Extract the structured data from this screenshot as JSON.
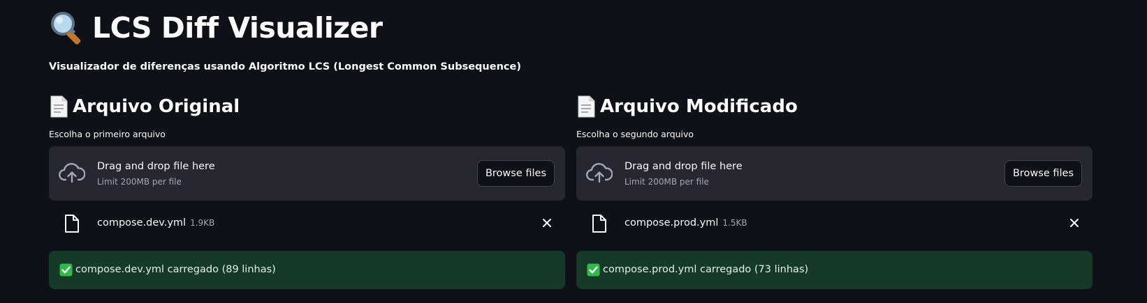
{
  "header": {
    "title_icon": "magnifying-glass-icon",
    "title": "LCS Diff Visualizer",
    "subtitle": "Visualizador de diferenças usando Algoritmo LCS (Longest Common Subsequence)"
  },
  "colors": {
    "background": "#0e1117",
    "dropzone": "#262730",
    "success_bg": "#173928",
    "text": "#fafafa",
    "muted_text": "#a3a8b8"
  },
  "original": {
    "icon": "page-icon",
    "heading": "Arquivo Original",
    "uploader_label": "Escolha o primeiro arquivo",
    "dropzone_text": "Drag and drop file here",
    "dropzone_limit": "Limit 200MB per file",
    "browse_label": "Browse files",
    "file_name": "compose.dev.yml",
    "file_size": "1.9KB",
    "success_message": "compose.dev.yml carregado (89 linhas)"
  },
  "modified": {
    "icon": "page-icon",
    "heading": "Arquivo Modificado",
    "uploader_label": "Escolha o segundo arquivo",
    "dropzone_text": "Drag and drop file here",
    "dropzone_limit": "Limit 200MB per file",
    "browse_label": "Browse files",
    "file_name": "compose.prod.yml",
    "file_size": "1.5KB",
    "success_message": "compose.prod.yml carregado (73 linhas)"
  }
}
